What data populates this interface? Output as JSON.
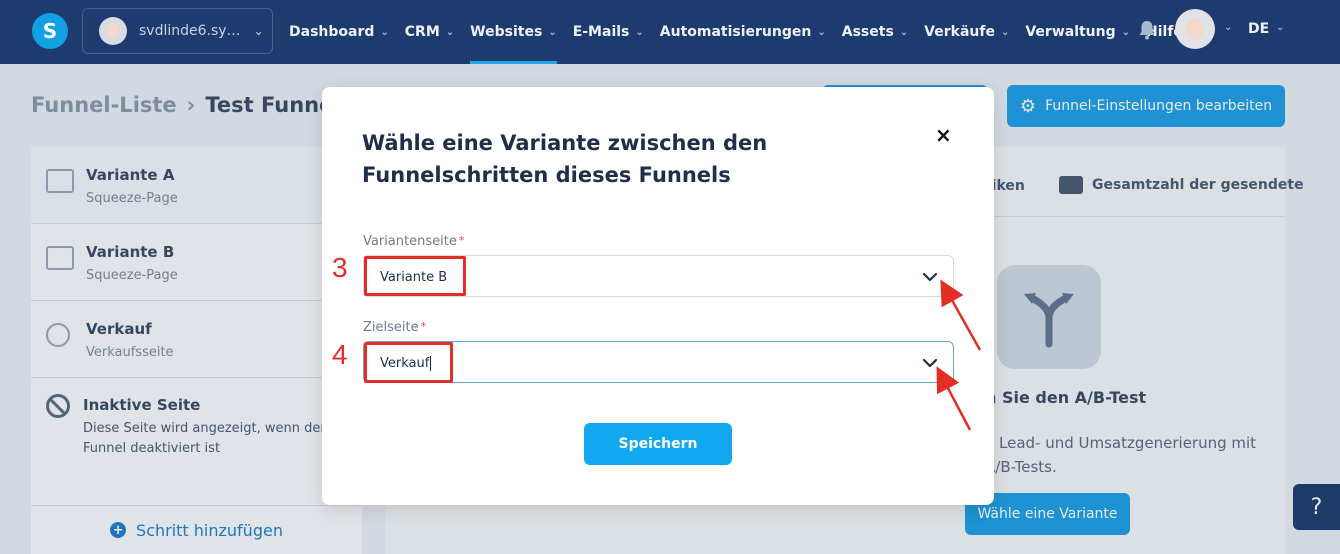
{
  "nav": {
    "logo": "S",
    "account": "svdlinde6.sy…",
    "items": [
      {
        "label": "Dashboard",
        "caret": true
      },
      {
        "label": "CRM",
        "caret": true
      },
      {
        "label": "Websites",
        "caret": true,
        "active": true
      },
      {
        "label": "E-Mails",
        "caret": true
      },
      {
        "label": "Automatisierungen",
        "caret": true
      },
      {
        "label": "Assets",
        "caret": true
      },
      {
        "label": "Verkäufe",
        "caret": true
      },
      {
        "label": "Verwaltung",
        "caret": true
      },
      {
        "label": "Hilfe",
        "caret": false
      }
    ],
    "language": "DE"
  },
  "breadcrumb": {
    "parent": "Funnel-Liste",
    "current": "Test Funnel"
  },
  "settings_button": "Funnel-Einstellungen bearbeiten",
  "sidebar": {
    "steps": [
      {
        "title": "Variante A",
        "subtitle": "Squeeze-Page"
      },
      {
        "title": "Variante B",
        "subtitle": "Squeeze-Page"
      },
      {
        "title": "Verkauf",
        "subtitle": "Verkaufsseite"
      }
    ],
    "inactive_title": "Inaktive Seite",
    "inactive_description": "Diese Seite wird angezeigt, wenn der Funnel deaktiviert ist",
    "add_step": "Schritt hinzufügen"
  },
  "panel": {
    "tab_stats": "tiken",
    "tab_total": "Gesamtzahl der gesendete",
    "ab_title": "n Sie den A/B-Test",
    "ab_description": "e Lead- und Umsatzgenerierung mit A/B-Tests.",
    "choose_button": "Wähle eine Variante"
  },
  "help": "?",
  "modal": {
    "title": "Wähle eine Variante zwischen den Funnelschritten dieses Funnels",
    "close": "×",
    "variant_label": "Variantenseite",
    "variant_value": "Variante B",
    "target_label": "Zielseite",
    "target_value": "Verkauf",
    "required_mark": "*",
    "save_button": "Speichern"
  },
  "annotations": {
    "step3": "3",
    "step4": "4",
    "color": "#e32d25"
  },
  "colors": {
    "nav_bg": "#1d3b6e",
    "accent": "#1f9ee4",
    "save_button": "#12a8f0"
  }
}
